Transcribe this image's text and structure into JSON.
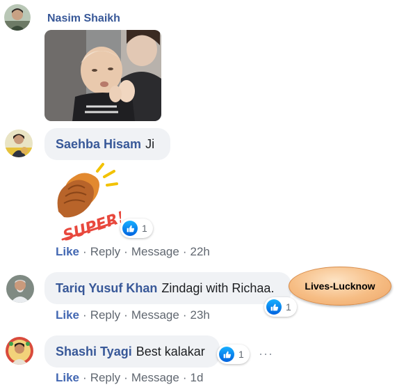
{
  "comments": [
    {
      "name": "Nasim Shaikh",
      "text": "",
      "attachment": "baby-clapping-gif"
    },
    {
      "name": "Saehba Hisam",
      "text": "Ji",
      "sticker": {
        "label": "SUPER!",
        "icon": "clapping-hands-sticker"
      },
      "reaction_count": "1",
      "actions": {
        "like": "Like",
        "reply": "Reply",
        "message": "Message",
        "time": "22h"
      }
    },
    {
      "name": "Tariq Yusuf Khan",
      "text": "Zindagi with Richaa.",
      "reaction_count": "1",
      "actions": {
        "like": "Like",
        "reply": "Reply",
        "message": "Message",
        "time": "23h"
      }
    },
    {
      "name": "Shashi Tyagi",
      "text": "Best kalakar",
      "reaction_count": "1",
      "actions": {
        "like": "Like",
        "reply": "Reply",
        "message": "Message",
        "time": "1d"
      }
    }
  ],
  "callout": {
    "text": "Lives-Lucknow"
  },
  "separator": "·",
  "more_icon": "···",
  "colors": {
    "name": "#385898",
    "like": "#4267b2",
    "bubble": "#f0f2f5",
    "callout": "#f6bd84"
  }
}
